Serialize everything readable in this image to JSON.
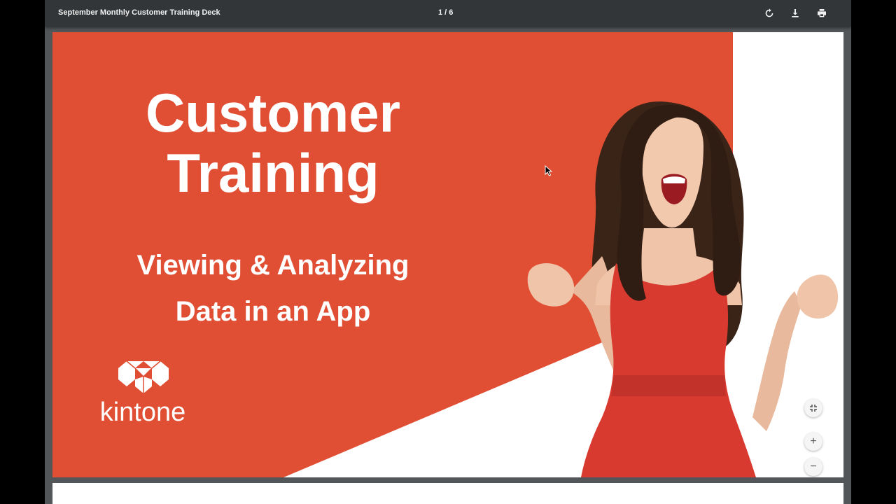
{
  "viewer": {
    "document_title": "September Monthly Customer Training Deck",
    "page_counter": "1 / 6",
    "icons": {
      "rotate": "rotate-icon",
      "download": "download-icon",
      "print": "print-icon"
    }
  },
  "slide": {
    "title_line1": "Customer",
    "title_line2": "Training",
    "subtitle_line1": "Viewing & Analyzing",
    "subtitle_line2": "Data in an App",
    "logo_text": "kintone",
    "accent_color": "#E04E33",
    "text_color": "#FFFFFF",
    "dress_color": "#D93A30"
  },
  "zoom_controls": {
    "fit_icon": "fit-to-page-icon",
    "zoom_in_label": "+",
    "zoom_out_label": "−"
  }
}
